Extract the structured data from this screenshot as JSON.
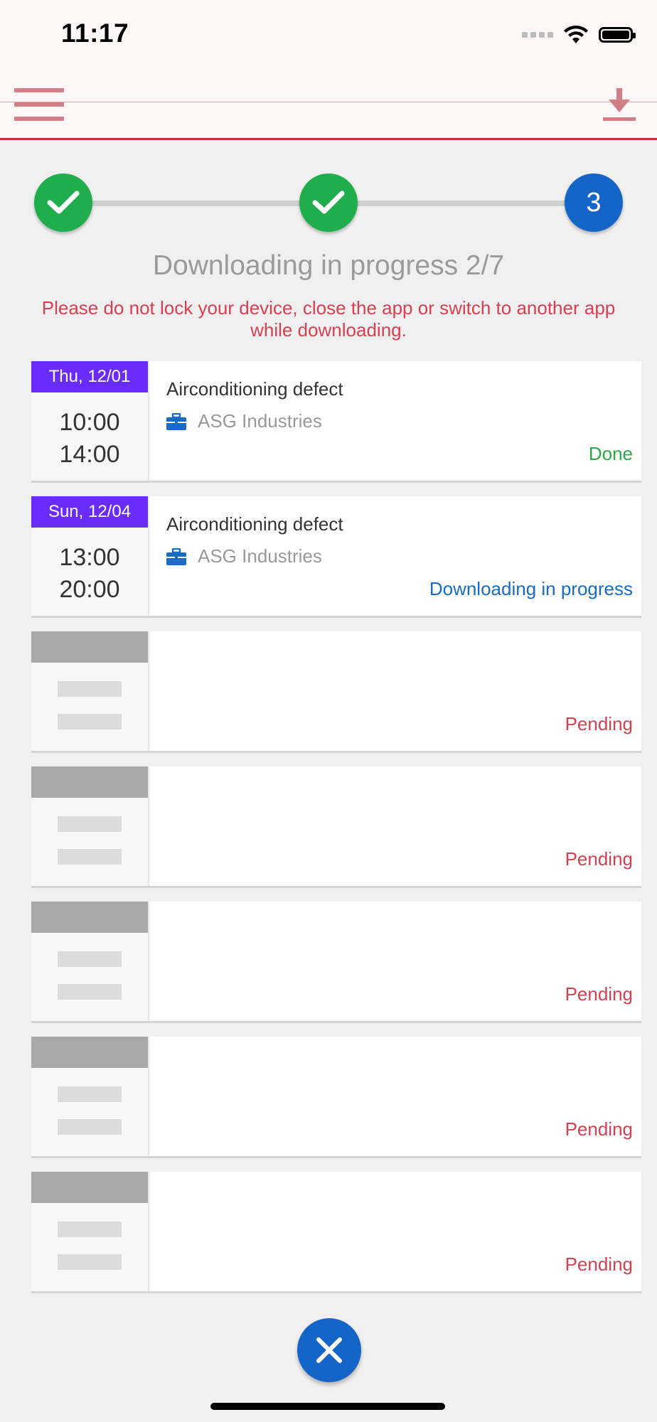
{
  "status_bar": {
    "time": "11:17"
  },
  "stepper": {
    "steps": [
      {
        "state": "done",
        "icon": "check-icon"
      },
      {
        "state": "done",
        "icon": "check-icon"
      },
      {
        "state": "current",
        "label": "3"
      }
    ]
  },
  "title": "Downloading in progress 2/7",
  "warning": "Please do not lock your device, close the app or switch to another app while downloading.",
  "appointments": [
    {
      "date": "Thu, 12/01",
      "start": "10:00",
      "end": "14:00",
      "subject": "Airconditioning defect",
      "company": "ASG Industries",
      "status": "Done"
    },
    {
      "date": "Sun, 12/04",
      "start": "13:00",
      "end": "20:00",
      "subject": "Airconditioning defect",
      "company": "ASG Industries",
      "status": "Downloading in progress"
    },
    {
      "status": "Pending"
    },
    {
      "status": "Pending"
    },
    {
      "status": "Pending"
    },
    {
      "status": "Pending"
    },
    {
      "status": "Pending"
    }
  ],
  "colors": {
    "accent": "#c62d3a",
    "date_header": "#6a2cfc",
    "done": "#2fa84a",
    "in_progress": "#1a6bc4",
    "pending": "#d64050",
    "primary_button": "#1565c9"
  }
}
